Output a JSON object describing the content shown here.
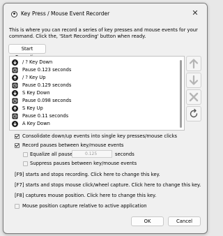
{
  "window": {
    "title": "Key Press / Mouse Event Recorder",
    "close_glyph": "✕"
  },
  "intro": "This is where you can record a series of key presses and mouse events for your command.  Click the, 'Start Recording' button when ready.",
  "start_button": "Start Recording",
  "events": [
    {
      "icon": "key-down-icon",
      "label": "/ ? Key Down"
    },
    {
      "icon": "pause-icon",
      "label": "Pause 0.123 seconds"
    },
    {
      "icon": "key-up-icon",
      "label": "/ ? Key Up"
    },
    {
      "icon": "pause-icon",
      "label": "Pause 0.129 seconds"
    },
    {
      "icon": "key-down-icon",
      "label": "S Key Down"
    },
    {
      "icon": "pause-icon",
      "label": "Pause 0.098 seconds"
    },
    {
      "icon": "key-up-icon",
      "label": "S Key Up"
    },
    {
      "icon": "pause-icon",
      "label": "Pause 0.11 seconds"
    },
    {
      "icon": "key-down-icon",
      "label": "A Key Down"
    }
  ],
  "side_buttons": [
    {
      "name": "move-up-button",
      "icon": "arrow-up-icon",
      "enabled": false
    },
    {
      "name": "move-down-button",
      "icon": "arrow-down-icon",
      "enabled": false
    },
    {
      "name": "delete-button",
      "icon": "x-icon",
      "enabled": false
    },
    {
      "name": "reset-button",
      "icon": "refresh-icon",
      "enabled": true
    }
  ],
  "options": {
    "consolidate": {
      "label": "Consolidate down/up events into single key presses/mouse clicks",
      "checked": true
    },
    "record_pauses": {
      "label": "Record pauses between key/mouse events",
      "checked": true
    },
    "equalize": {
      "label": "Equalize all pauses to",
      "checked": false,
      "enabled": false
    },
    "pause_value": "0.125",
    "seconds_label": "seconds",
    "suppress": {
      "label": "Suppress pauses between key/mouse events",
      "checked": false,
      "enabled": false
    },
    "relative": {
      "label": "Mouse position capture relative to active application",
      "checked": false,
      "enabled": false
    }
  },
  "hints": {
    "f9": "[F9] starts and stops recording.  Click here to change this key.",
    "f7": "[F7] starts and stops mouse click/wheel capture.  Click here to change this key.",
    "f8": "[F8] captures mouse position.  Click here to change this key."
  },
  "footer": {
    "ok": "OK",
    "cancel": "Cancel"
  },
  "colors": {
    "enabled_icon": "#555555",
    "disabled_icon": "#b5b5b5"
  }
}
